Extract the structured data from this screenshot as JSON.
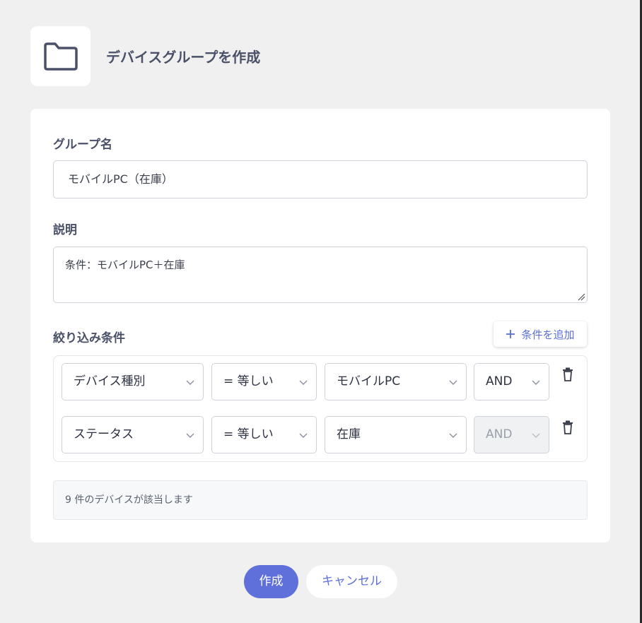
{
  "header": {
    "title": "デバイスグループを作成",
    "icon": "folder-icon"
  },
  "form": {
    "group_name": {
      "label": "グループ名",
      "value": "モバイルPC（在庫）"
    },
    "description": {
      "label": "説明",
      "value": "条件：モバイルPC＋在庫"
    },
    "filters": {
      "label": "絞り込み条件",
      "add_label": "条件を追加",
      "rows": [
        {
          "field": "デバイス種別",
          "operator": "= 等しい",
          "value": "モバイルPC",
          "logic": "AND",
          "logic_disabled": false
        },
        {
          "field": "ステータス",
          "operator": "= 等しい",
          "value": "在庫",
          "logic": "AND",
          "logic_disabled": true
        }
      ]
    },
    "match_text": "9 件のデバイスが該当します"
  },
  "actions": {
    "create_label": "作成",
    "cancel_label": "キャンセル"
  },
  "colors": {
    "accent": "#6070db",
    "text_dark": "#4a5168"
  }
}
